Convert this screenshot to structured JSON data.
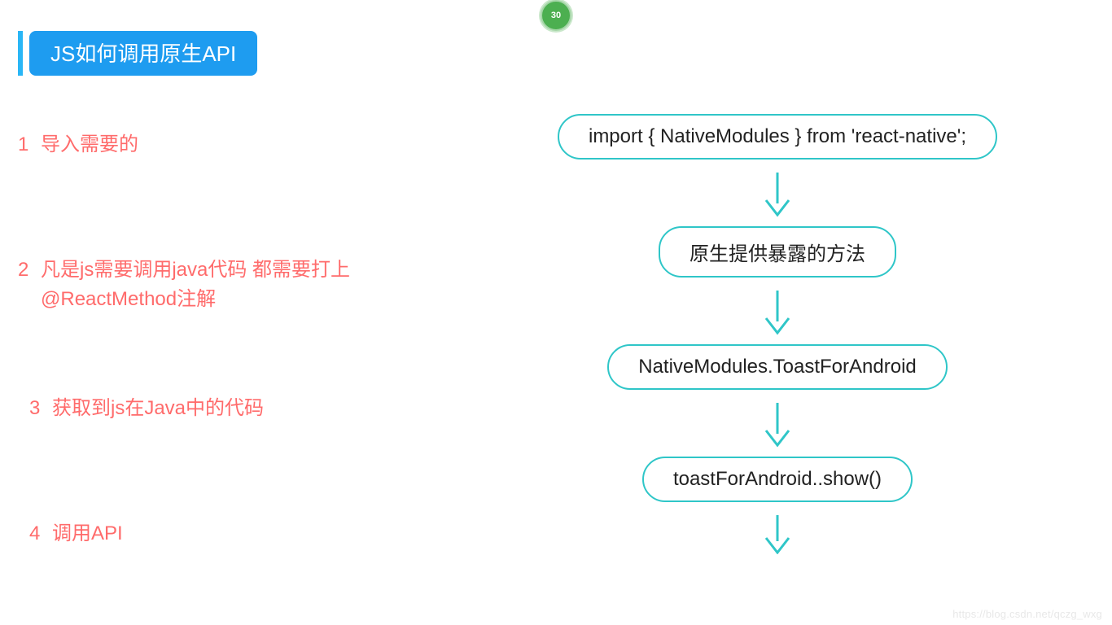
{
  "badge": "30",
  "title": "JS如何调用原生API",
  "steps": [
    {
      "num": "1",
      "text": "导入需要的"
    },
    {
      "num": "2",
      "text": "凡是js需要调用java代码 都需要打上@ReactMethod注解"
    },
    {
      "num": "3",
      "text": "获取到js在Java中的代码"
    },
    {
      "num": "4",
      "text": "调用API"
    }
  ],
  "flow_nodes": [
    "import { NativeModules } from 'react-native';",
    "原生提供暴露的方法",
    "NativeModules.ToastForAndroid",
    "toastForAndroid..show()"
  ],
  "colors": {
    "accent_blue": "#1e9cf0",
    "step_red": "#ff6b6b",
    "node_border": "#2fc6c8",
    "badge_green": "#4caf50"
  },
  "watermark": "https://blog.csdn.net/qczg_wxg"
}
